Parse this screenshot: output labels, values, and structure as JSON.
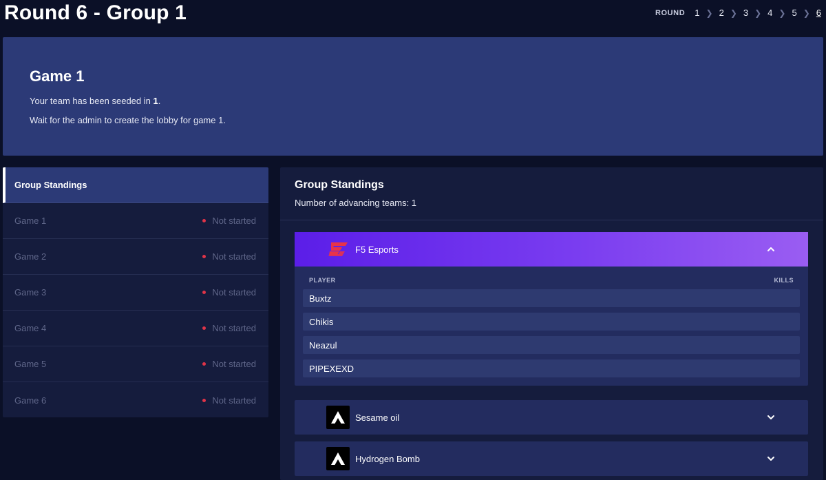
{
  "page": {
    "title": "Round 6 - Group 1"
  },
  "round_nav": {
    "label": "ROUND",
    "rounds": [
      "1",
      "2",
      "3",
      "4",
      "5",
      "6"
    ],
    "active": "6"
  },
  "game_banner": {
    "title": "Game 1",
    "seed_text_prefix": "Your team has been seeded in ",
    "seed_value": "1",
    "seed_text_suffix": ".",
    "wait_text": "Wait for the admin to create the lobby for game 1."
  },
  "left_panel": {
    "active_label": "Group Standings",
    "games": [
      {
        "label": "Game 1",
        "status": "Not started"
      },
      {
        "label": "Game 2",
        "status": "Not started"
      },
      {
        "label": "Game 3",
        "status": "Not started"
      },
      {
        "label": "Game 4",
        "status": "Not started"
      },
      {
        "label": "Game 5",
        "status": "Not started"
      },
      {
        "label": "Game 6",
        "status": "Not started"
      }
    ]
  },
  "standings": {
    "title": "Group Standings",
    "advancing_text": "Number of advancing teams: 1",
    "player_col": "PLAYER",
    "kills_col": "KILLS",
    "teams": [
      {
        "name": "F5 Esports",
        "logo": "f5-logo",
        "expanded": true,
        "players": [
          "Buxtz",
          "Chikis",
          "Neazul",
          "PIPEXEXD"
        ]
      },
      {
        "name": "Sesame oil",
        "logo": "apex-logo",
        "expanded": false,
        "players": []
      },
      {
        "name": "Hydrogen Bomb",
        "logo": "apex-logo",
        "expanded": false,
        "players": []
      }
    ]
  },
  "colors": {
    "background": "#0b1027",
    "banner": "#2c3a77",
    "panel": "#151c3d",
    "status_dot": "#e03448",
    "expanded_gradient_start": "#5b1ee8",
    "expanded_gradient_end": "#9a5df2"
  }
}
